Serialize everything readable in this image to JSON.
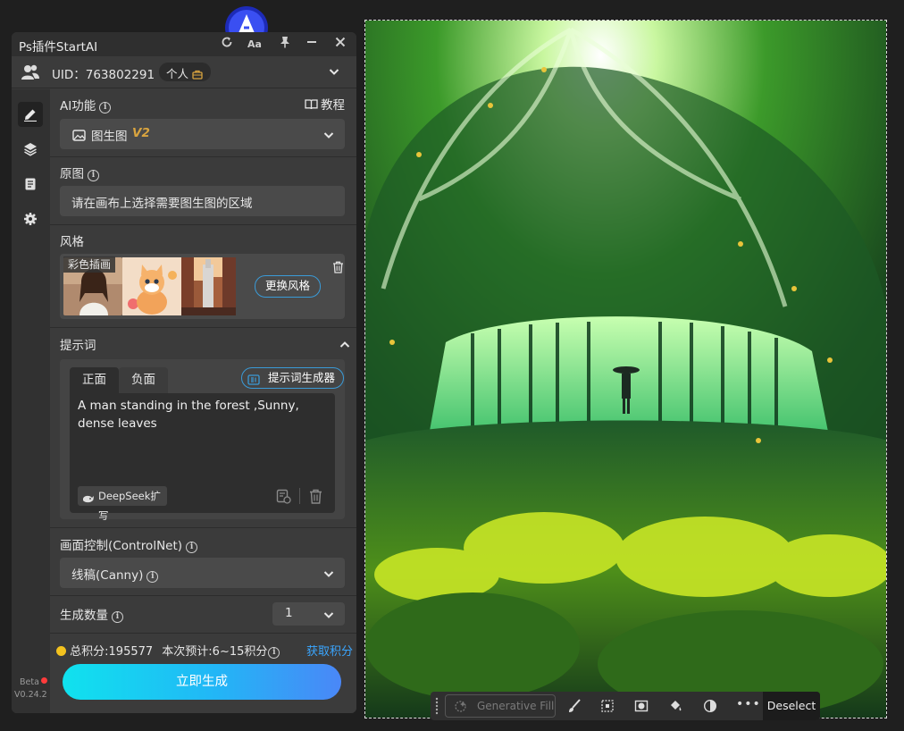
{
  "app": {
    "title": "Ps插件StartAI"
  },
  "titlebar": {
    "font_btn_label": "Aa"
  },
  "user": {
    "uid_text": "UID：763802291",
    "plan_label": "个人"
  },
  "ai_function": {
    "label": "AI功能",
    "tutorial_label": "教程",
    "selected_name": "图生图",
    "selected_version": "V2"
  },
  "source_image": {
    "label": "原图",
    "placeholder": "请在画布上选择需要图生图的区域"
  },
  "style": {
    "label": "风格",
    "current_style": "彩色插画",
    "change_button": "更换风格"
  },
  "prompt": {
    "label": "提示词",
    "tab_positive": "正面",
    "tab_negative": "负面",
    "generator_button": "提示词生成器",
    "text": "A man standing in the forest ,Sunny, dense leaves",
    "deepseek_button": "DeepSeek扩写"
  },
  "controlnet": {
    "label": "画面控制(ControlNet)",
    "selected": "线稿(Canny)"
  },
  "quantity": {
    "label": "生成数量",
    "value": "1"
  },
  "points": {
    "total": "总积分:195577",
    "estimate": "本次预计:6~15积分",
    "get_points": "获取积分"
  },
  "generate_button": "立即生成",
  "version": {
    "beta": "Beta",
    "number": "V0.24.2"
  },
  "ps_taskbar": {
    "generative_fill": "Generative Fill",
    "deselect": "Deselect"
  },
  "colors": {
    "panel_bg": "#3b3b3b",
    "accent_blue": "#3a9bd8",
    "points_link": "#3aa6ff",
    "version_gold": "#d9a43f",
    "coin": "#f3c21e"
  }
}
